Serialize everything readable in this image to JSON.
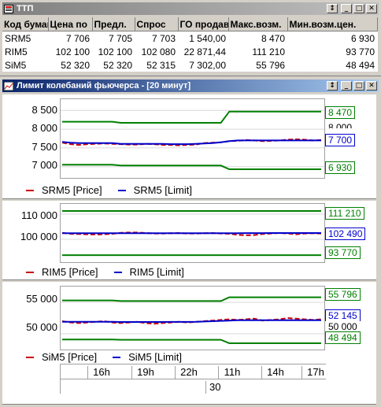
{
  "win1": {
    "title": "ТТП",
    "columns": [
      "Код бумаг",
      "Цена по",
      "Предл.",
      "Спрос",
      "ГО продав",
      "Макс.возм.",
      "Мин.возм.цен."
    ],
    "rows": [
      [
        "SRM5",
        "7 706",
        "7 705",
        "7 703",
        "1 540,00",
        "8 470",
        "6 930"
      ],
      [
        "RIM5",
        "102 100",
        "102 100",
        "102 080",
        "22 871,44",
        "111 210",
        "93 770"
      ],
      [
        "SiM5",
        "52 320",
        "52 320",
        "52 315",
        "7 302,00",
        "55 796",
        "48 494"
      ]
    ]
  },
  "win2": {
    "title": "Лимит колебаний фьючерса - [20 минут]",
    "colors": {
      "price": "#cc0000",
      "limit": "#0000cc",
      "bound": "#008000"
    },
    "panels": [
      {
        "scale_labels": [
          "8 500",
          "8 000",
          "7 500",
          "7 000"
        ],
        "scale_values": [
          8500,
          8000,
          7500,
          7000
        ],
        "y_range": [
          6700,
          8800
        ],
        "upper_label": "8 470",
        "limit_label": "7 700",
        "ghost_label": "8 000",
        "lower_label": "6 930",
        "series": {
          "upper": [
            8200,
            8200,
            8200,
            8200,
            8200,
            8200,
            8200,
            8170,
            8170,
            8170,
            8170,
            8170,
            8170,
            8170,
            8170,
            8170,
            8170,
            8170,
            8170,
            8170,
            8470,
            8470,
            8470,
            8470,
            8470,
            8470,
            8470,
            8470,
            8470,
            8470,
            8470,
            8470
          ],
          "limit": [
            7660,
            7640,
            7630,
            7630,
            7630,
            7630,
            7630,
            7610,
            7610,
            7610,
            7610,
            7610,
            7610,
            7600,
            7600,
            7600,
            7610,
            7620,
            7630,
            7650,
            7680,
            7700,
            7700,
            7700,
            7700,
            7700,
            7700,
            7700,
            7700,
            7700,
            7700,
            7700
          ],
          "price": [
            7640,
            7600,
            7580,
            7600,
            7610,
            7620,
            7610,
            7600,
            7590,
            7590,
            7610,
            7600,
            7580,
            7580,
            7570,
            7580,
            7590,
            7630,
            7640,
            7650,
            7680,
            7690,
            7710,
            7700,
            7680,
            7690,
            7700,
            7720,
            7730,
            7720,
            7700,
            7710
          ],
          "lower": [
            7050,
            7050,
            7050,
            7050,
            7050,
            7050,
            7050,
            7030,
            7030,
            7030,
            7030,
            7030,
            7030,
            7030,
            7030,
            7030,
            7030,
            7030,
            7030,
            7030,
            6930,
            6930,
            6930,
            6930,
            6930,
            6930,
            6930,
            6930,
            6930,
            6930,
            6930,
            6930
          ]
        },
        "legend": {
          "price": "SRM5 [Price]",
          "limit": "SRM5 [Limit]"
        }
      },
      {
        "scale_labels": [
          "110 000",
          "100 000"
        ],
        "scale_values": [
          110000,
          100000
        ],
        "y_range": [
          91000,
          114000
        ],
        "upper_label": "111 210",
        "limit_label": "102 490",
        "lower_label": "93 770",
        "series": {
          "upper": [
            111210,
            111210,
            111210,
            111210,
            111210,
            111210,
            111210,
            111210,
            111210,
            111210,
            111210,
            111210,
            111210,
            111210,
            111210,
            111210,
            111210,
            111210,
            111210,
            111210,
            111210,
            111210,
            111210,
            111210,
            111210,
            111210,
            111210,
            111210,
            111210,
            111210,
            111210,
            111210
          ],
          "limit": [
            102400,
            102400,
            102400,
            102400,
            102400,
            102400,
            102400,
            102420,
            102420,
            102420,
            102420,
            102420,
            102420,
            102400,
            102400,
            102400,
            102400,
            102410,
            102420,
            102430,
            102440,
            102450,
            102460,
            102470,
            102480,
            102490,
            102490,
            102490,
            102490,
            102490,
            102490,
            102490
          ],
          "price": [
            102600,
            102200,
            102100,
            102000,
            101900,
            102000,
            102200,
            102600,
            102700,
            102700,
            102500,
            102300,
            102300,
            102400,
            102500,
            102300,
            102300,
            102400,
            102500,
            102300,
            102200,
            101800,
            101600,
            101700,
            102100,
            102300,
            102500,
            102300,
            102000,
            102300,
            102400,
            102300
          ],
          "lower": [
            93770,
            93770,
            93770,
            93770,
            93770,
            93770,
            93770,
            93770,
            93770,
            93770,
            93770,
            93770,
            93770,
            93770,
            93770,
            93770,
            93770,
            93770,
            93770,
            93770,
            93770,
            93770,
            93770,
            93770,
            93770,
            93770,
            93770,
            93770,
            93770,
            93770,
            93770,
            93770
          ]
        },
        "legend": {
          "price": "RIM5 [Price]",
          "limit": "RIM5 [Limit]"
        }
      },
      {
        "scale_labels": [
          "55 000",
          "50 000"
        ],
        "scale_values": [
          55000,
          50000
        ],
        "y_range": [
          47500,
          57500
        ],
        "upper_label": "55 796",
        "limit_label": "52 145",
        "ghost_label": "50 000",
        "lower_label": "48 494",
        "series": {
          "upper": [
            55300,
            55300,
            55300,
            55300,
            55300,
            55300,
            55300,
            55200,
            55200,
            55200,
            55200,
            55200,
            55200,
            55200,
            55200,
            55200,
            55200,
            55200,
            55200,
            55200,
            55796,
            55796,
            55796,
            55796,
            55796,
            55796,
            55796,
            55796,
            55796,
            55796,
            55796,
            55796
          ],
          "limit": [
            51900,
            51900,
            51900,
            51900,
            51900,
            51900,
            51900,
            51880,
            51880,
            51880,
            51880,
            51880,
            51880,
            51890,
            51890,
            51890,
            51900,
            51950,
            52000,
            52050,
            52100,
            52145,
            52145,
            52145,
            52145,
            52145,
            52145,
            52145,
            52145,
            52145,
            52145,
            52145
          ],
          "price": [
            52000,
            51800,
            51700,
            51800,
            51900,
            52000,
            51800,
            51700,
            51800,
            51900,
            51700,
            51600,
            51700,
            51800,
            51900,
            51800,
            51900,
            52000,
            52100,
            52200,
            52300,
            52200,
            52300,
            52400,
            52100,
            52200,
            52300,
            52500,
            52400,
            52300,
            52200,
            52300
          ],
          "lower": [
            49100,
            49100,
            49100,
            49100,
            49100,
            49100,
            49100,
            49050,
            49050,
            49050,
            49050,
            49050,
            49050,
            49050,
            49050,
            49050,
            49050,
            49050,
            49050,
            49050,
            48494,
            48494,
            48494,
            48494,
            48494,
            48494,
            48494,
            48494,
            48494,
            48494,
            48494,
            48494
          ]
        },
        "legend": {
          "price": "SiM5 [Price]",
          "limit": "SiM5 [Limit]"
        }
      }
    ],
    "time_ticks": [
      "16h",
      "19h",
      "22h",
      "11h",
      "14h",
      "17h"
    ],
    "date_label": "30"
  }
}
